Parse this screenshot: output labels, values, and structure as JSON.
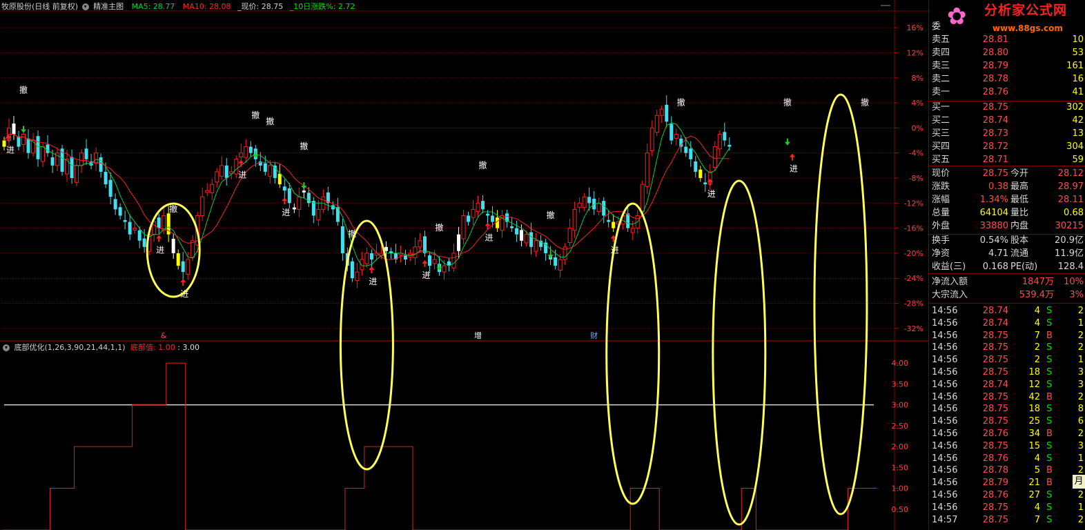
{
  "header": {
    "stock_title": "牧原股份(日线 前复权)",
    "indicator_name": "精准主图",
    "ma5_label": "MA5: 28.77",
    "ma10_label": "MA10: 28.08",
    "price_label": "_现价: 28.75",
    "change10_label": "_10日涨跌%: 2.72"
  },
  "sub_header": {
    "name": "底部优化(1,26,3,90,21,44,1,1)",
    "series_label": "底部值: 1.00",
    "ref_label": ": 3.00"
  },
  "colors": {
    "up": "#ff2020",
    "down": "#40e0f0",
    "signal": "#ffff00",
    "flat": "#ffffff",
    "ma5": "#00d040",
    "ma10": "#ff2020",
    "circle": "#ffff55",
    "grid": "#800000"
  },
  "chart_data": [
    {
      "type": "candlestick",
      "title": "牧原股份(日线 前复权)",
      "y_axis": {
        "ticks": [
          "16%",
          "12%",
          "8%",
          "4%",
          "0%",
          "-4%",
          "-8%",
          "-12%",
          "-16%",
          "-20%",
          "-24%",
          "-28%",
          "-32%"
        ],
        "range": [
          -34,
          18
        ],
        "unit": "%"
      },
      "series_names": [
        "MA5",
        "MA10"
      ],
      "close_pct": [
        -2,
        0,
        -1,
        -3,
        -1,
        -4,
        -2,
        -5,
        -3,
        -4,
        -6,
        -4,
        -7,
        -5,
        -8,
        -6,
        -4,
        -5,
        -6,
        -4,
        -7,
        -9,
        -11,
        -13,
        -14,
        -15,
        -17,
        -16,
        -18,
        -19,
        -17,
        -15,
        -16,
        -14,
        -17,
        -20,
        -22,
        -23,
        -21,
        -18,
        -14,
        -11,
        -10,
        -9,
        -7,
        -6,
        -8,
        -7,
        -5,
        -4,
        -3,
        -4,
        -5,
        -6,
        -7,
        -6,
        -8,
        -9,
        -10,
        -12,
        -13,
        -11,
        -10,
        -12,
        -14,
        -13,
        -11,
        -12,
        -13,
        -15,
        -20,
        -22,
        -24,
        -23,
        -21,
        -20,
        -21,
        -20,
        -20,
        -19,
        -20,
        -21,
        -20,
        -21,
        -20,
        -19,
        -18,
        -20,
        -22,
        -21,
        -23,
        -22,
        -22,
        -20,
        -17,
        -14,
        -15,
        -13,
        -12,
        -13,
        -14,
        -15,
        -16,
        -14,
        -15,
        -16,
        -17,
        -18,
        -17,
        -19,
        -18,
        -19,
        -20,
        -21,
        -22,
        -21,
        -19,
        -16,
        -13,
        -12,
        -11,
        -12,
        -13,
        -12,
        -14,
        -15,
        -16,
        -15,
        -14,
        -16,
        -16,
        -14,
        -9,
        -4,
        0,
        2,
        3,
        1,
        -2,
        -1,
        -3,
        -4,
        -5,
        -7,
        -8,
        -9,
        -7,
        -3,
        -1,
        -2,
        -3
      ],
      "annotations": {
        "buy": [
          {
            "i": 1,
            "label": "进"
          },
          {
            "i": 32,
            "label": "进"
          },
          {
            "i": 37,
            "label": "进"
          },
          {
            "i": 49,
            "label": "进"
          },
          {
            "i": 58,
            "label": "进"
          },
          {
            "i": 76,
            "label": "进"
          },
          {
            "i": 87,
            "label": "进"
          },
          {
            "i": 100,
            "label": "进"
          },
          {
            "i": 126,
            "label": "进"
          },
          {
            "i": 146,
            "label": "进"
          },
          {
            "i": 163,
            "label": "进"
          }
        ],
        "sell": [
          {
            "i": 4,
            "label": "撤"
          },
          {
            "i": 35,
            "label": "撤"
          },
          {
            "i": 52,
            "label": "撤"
          },
          {
            "i": 55,
            "label": "撤"
          },
          {
            "i": 62,
            "label": "撤"
          },
          {
            "i": 72,
            "label": "撤"
          },
          {
            "i": 90,
            "label": "撤"
          },
          {
            "i": 99,
            "label": "撤"
          },
          {
            "i": 113,
            "label": "撤"
          },
          {
            "i": 140,
            "label": "撤"
          },
          {
            "i": 162,
            "label": "撤"
          },
          {
            "i": 178,
            "label": "撤"
          }
        ],
        "events": [
          {
            "i": 33,
            "label": "&"
          },
          {
            "i": 98,
            "label": "增"
          },
          {
            "i": 122,
            "label": "财"
          }
        ]
      }
    },
    {
      "type": "step-line",
      "title": "底部优化(1,26,3,90,21,44,1,1)",
      "series_names": [
        "底部值"
      ],
      "y_axis": {
        "ticks": [
          "4.00",
          "3.50",
          "3.00",
          "2.50",
          "2.00",
          "1.50",
          "1.00",
          "0.50"
        ],
        "range": [
          0,
          4.3
        ]
      },
      "reference_line": 3.0,
      "segments": [
        {
          "from": 0,
          "to": 9,
          "value": 0
        },
        {
          "from": 10,
          "to": 14,
          "value": 1
        },
        {
          "from": 15,
          "to": 16,
          "value": 2
        },
        {
          "from": 17,
          "to": 26,
          "value": 2
        },
        {
          "from": 27,
          "to": 33,
          "value": 3
        },
        {
          "from": 34,
          "to": 37,
          "value": 4
        },
        {
          "from": 38,
          "to": 70,
          "value": 0
        },
        {
          "from": 71,
          "to": 74,
          "value": 1
        },
        {
          "from": 75,
          "to": 84,
          "value": 2
        },
        {
          "from": 85,
          "to": 129,
          "value": 0
        },
        {
          "from": 130,
          "to": 135,
          "value": 1
        },
        {
          "from": 136,
          "to": 152,
          "value": 0
        },
        {
          "from": 153,
          "to": 155,
          "value": 1
        },
        {
          "from": 156,
          "to": 174,
          "value": 0
        },
        {
          "from": 175,
          "to": 180,
          "value": 1
        }
      ]
    }
  ],
  "logo": {
    "brand": "分析家公式网",
    "url": "www.88gs.com"
  },
  "quote": {
    "wei": "委",
    "asks": [
      {
        "label": "卖五",
        "price": "28.81",
        "vol": "10"
      },
      {
        "label": "卖四",
        "price": "28.80",
        "vol": "53"
      },
      {
        "label": "卖三",
        "price": "28.79",
        "vol": "161"
      },
      {
        "label": "卖二",
        "price": "28.78",
        "vol": "16"
      },
      {
        "label": "卖一",
        "price": "28.76",
        "vol": "41"
      }
    ],
    "bids": [
      {
        "label": "买一",
        "price": "28.75",
        "vol": "302"
      },
      {
        "label": "买二",
        "price": "28.74",
        "vol": "42"
      },
      {
        "label": "买三",
        "price": "28.73",
        "vol": "13"
      },
      {
        "label": "买四",
        "price": "28.72",
        "vol": "304"
      },
      {
        "label": "买五",
        "price": "28.71",
        "vol": "59"
      }
    ],
    "stats": [
      {
        "l1": "现价",
        "v1": "28.75",
        "l2": "今开",
        "v2": "28.12"
      },
      {
        "l1": "涨跌",
        "v1": "0.38",
        "l2": "最高",
        "v2": "28.97"
      },
      {
        "l1": "涨幅",
        "v1": "1.34%",
        "l2": "最低",
        "v2": "28.11"
      },
      {
        "l1": "总量",
        "v1": "64104",
        "l2": "量比",
        "v2": "0.68"
      },
      {
        "l1": "外盘",
        "v1": "33880",
        "l2": "内盘",
        "v2": "30215"
      }
    ],
    "stats2": [
      {
        "l1": "换手",
        "v1": "0.54%",
        "l2": "股本",
        "v2": "20.9亿"
      },
      {
        "l1": "净资",
        "v1": "4.71",
        "l2": "流通",
        "v2": "11.9亿"
      },
      {
        "l1": "收益(三)",
        "v1": "0.168",
        "l2": "PE(动)",
        "v2": "128.4"
      }
    ],
    "flows": [
      {
        "l": "净流入额",
        "v": "1847万",
        "p": "10%"
      },
      {
        "l": "大宗流入",
        "v": "539.4万",
        "p": "3%"
      }
    ],
    "ticks": [
      {
        "t": "14:56",
        "p": "28.74",
        "v": "4",
        "s": "S",
        "n": "2"
      },
      {
        "t": "14:56",
        "p": "28.74",
        "v": "4",
        "s": "S",
        "n": "1"
      },
      {
        "t": "14:56",
        "p": "28.75",
        "v": "7",
        "s": "B",
        "n": "2"
      },
      {
        "t": "14:56",
        "p": "28.75",
        "v": "2",
        "s": "S",
        "n": "2"
      },
      {
        "t": "14:56",
        "p": "28.75",
        "v": "2",
        "s": "S",
        "n": "1"
      },
      {
        "t": "14:56",
        "p": "28.75",
        "v": "18",
        "s": "S",
        "n": "3"
      },
      {
        "t": "14:56",
        "p": "28.74",
        "v": "12",
        "s": "S",
        "n": "3"
      },
      {
        "t": "14:56",
        "p": "28.75",
        "v": "42",
        "s": "B",
        "n": "2"
      },
      {
        "t": "14:56",
        "p": "28.75",
        "v": "18",
        "s": "S",
        "n": "8"
      },
      {
        "t": "14:56",
        "p": "28.75",
        "v": "25",
        "s": "S",
        "n": "6"
      },
      {
        "t": "14:56",
        "p": "28.76",
        "v": "34",
        "s": "B",
        "n": "2"
      },
      {
        "t": "14:56",
        "p": "28.75",
        "v": "15",
        "s": "S",
        "n": "3"
      },
      {
        "t": "14:56",
        "p": "28.76",
        "v": "4",
        "s": "S",
        "n": "1"
      },
      {
        "t": "14:56",
        "p": "28.78",
        "v": "5",
        "s": "B",
        "n": "2"
      },
      {
        "t": "14:56",
        "p": "28.79",
        "v": "21",
        "s": "B",
        "n": "2"
      },
      {
        "t": "14:56",
        "p": "28.76",
        "v": "27",
        "s": "S",
        "n": "2"
      },
      {
        "t": "14:56",
        "p": "28.75",
        "v": "4",
        "s": "S",
        "n": "1"
      },
      {
        "t": "14:57",
        "p": "28.75",
        "v": "7",
        "s": "S",
        "n": "2"
      }
    ],
    "period_button": "月"
  }
}
